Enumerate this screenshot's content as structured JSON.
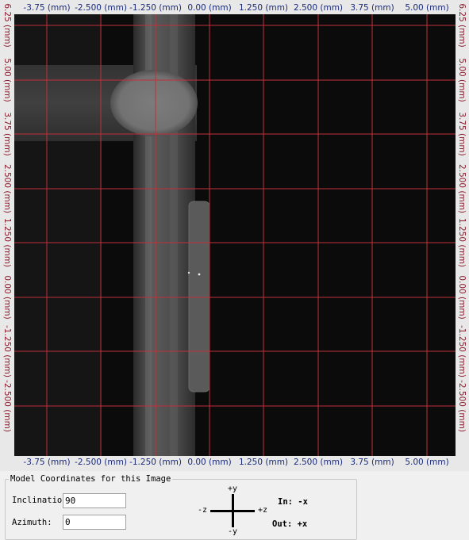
{
  "image_view": {
    "x_axis_labels": [
      "-3.75 (mm)",
      "-2.500 (mm)",
      "-1.250 (mm)",
      "0.00 (mm)",
      "1.250 (mm)",
      "2.500 (mm)",
      "3.75 (mm)",
      "5.00 (mm)"
    ],
    "y_axis_labels": [
      "6.25 (mm)",
      "5.00 (mm)",
      "3.75 (mm)",
      "2.500 (mm)",
      "1.250 (mm)",
      "0.00 (mm)",
      "-1.250 (mm)",
      "-2.500 (mm)"
    ],
    "grid_color": "#c0303a",
    "background_color": "#0b0b0b"
  },
  "model_panel": {
    "title": "Model Coordinates for this Image",
    "inclination_label": "Inclinatio",
    "inclination_value": "90",
    "azimuth_label": "Azimuth:",
    "azimuth_value": "0",
    "compass": {
      "up": "+y",
      "down": "-y",
      "left": "-z",
      "right": "+z"
    },
    "in_text": "In: -x",
    "out_text": "Out: +x"
  }
}
